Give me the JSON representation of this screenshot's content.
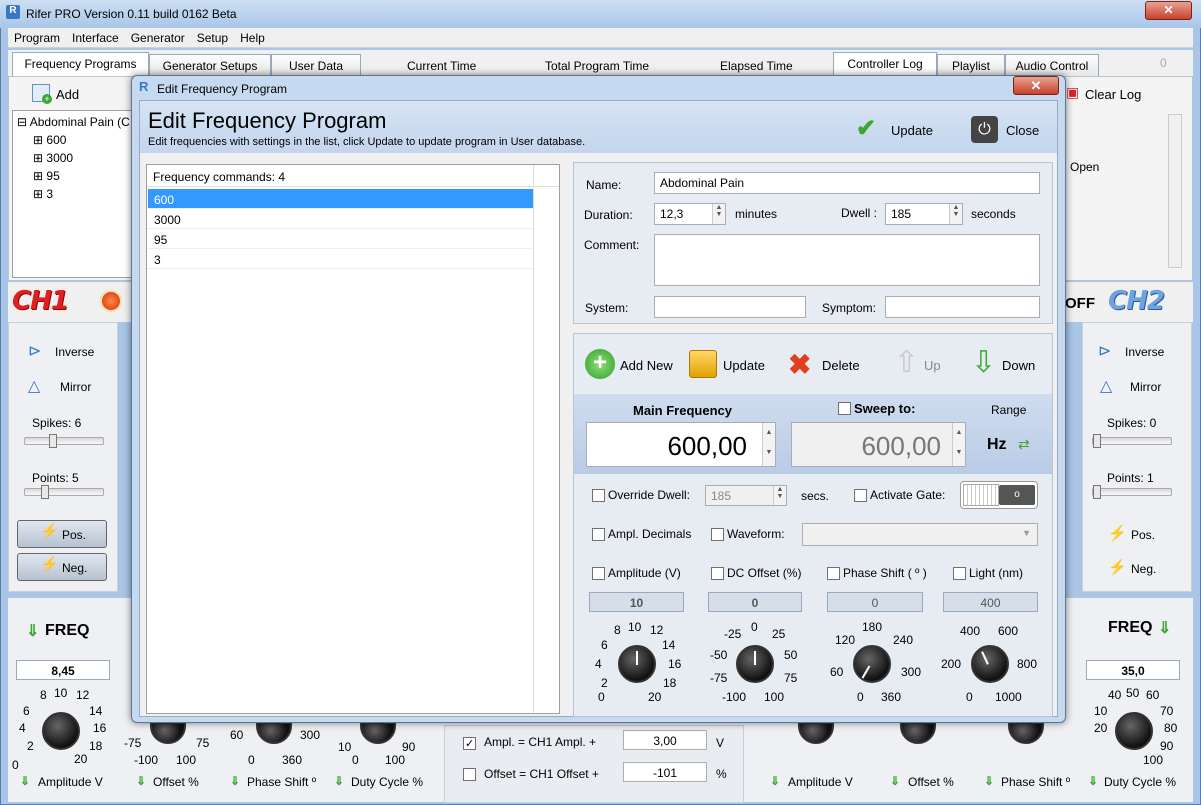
{
  "app": {
    "title": "Rifer PRO Version 0.11 build 0162 Beta"
  },
  "menu": [
    "Program",
    "Interface",
    "Generator",
    "Setup",
    "Help"
  ],
  "tabs": {
    "left": [
      "Frequency Programs",
      "Generator Setups",
      "User Data"
    ],
    "right": [
      "Controller Log",
      "Playlist",
      "Audio Control"
    ],
    "time_labels": [
      "Current Time",
      "Total Program Time",
      "Elapsed Time"
    ],
    "right_counter": "0"
  },
  "toolbar": {
    "add_label": "Add",
    "clear_log_label": "Clear Log",
    "open_label": "Open"
  },
  "tree": {
    "root": "Abdominal Pain (C",
    "items": [
      "600",
      "3000",
      "95",
      "3"
    ]
  },
  "ch1": {
    "label": "CH1",
    "inverse": "Inverse",
    "mirror": "Mirror",
    "spikes": "Spikes: 6",
    "points": "Points: 5",
    "pos": "Pos.",
    "neg": "Neg.",
    "freq_label": "FREQ",
    "freq_value": "8,45"
  },
  "ch2": {
    "label": "CH2",
    "off": "OFF",
    "inverse": "Inverse",
    "mirror": "Mirror",
    "spikes": "Spikes: 0",
    "points": "Points: 1",
    "pos": "Pos.",
    "neg": "Neg.",
    "freq_label": "FREQ",
    "freq_value": "35,0"
  },
  "bottom": {
    "amplitude_label": "Amplitude V",
    "offset_label": "Offset %",
    "phase_label": "Phase Shift º",
    "duty_label": "Duty Cycle %",
    "ampl_link": "Ampl. = CH1 Ampl. +",
    "ampl_link_value": "3,00",
    "ampl_unit": "V",
    "offset_link": "Offset = CH1 Offset +",
    "offset_link_value": "-101",
    "offset_unit": "%",
    "amp_ticks": [
      "0",
      "2",
      "4",
      "6",
      "8",
      "10",
      "12",
      "14",
      "16",
      "18",
      "20"
    ],
    "offset_ticks": [
      "-75",
      "-100",
      "100",
      "75"
    ],
    "phase_ticks": [
      "60",
      "0",
      "360",
      "300"
    ],
    "duty_ticks": [
      "10",
      "0",
      "100",
      "90"
    ],
    "right_amp_ticks": [
      "20",
      "40",
      "50",
      "60",
      "70",
      "80",
      "90",
      "100",
      "10"
    ]
  },
  "dialog": {
    "window_title": "Edit Frequency Program",
    "heading": "Edit Frequency Program",
    "subtitle": "Edit frequencies with settings in the list, click Update to update program in User database.",
    "update": "Update",
    "close": "Close",
    "list_header": "Frequency commands: 4",
    "frequencies": [
      "600",
      "3000",
      "95",
      "3"
    ],
    "name_label": "Name:",
    "name_value": "Abdominal Pain",
    "duration_label": "Duration:",
    "duration_value": "12,3",
    "duration_unit": "minutes",
    "dwell_label": "Dwell :",
    "dwell_value": "185",
    "dwell_unit": "seconds",
    "comment_label": "Comment:",
    "system_label": "System:",
    "symptom_label": "Symptom:",
    "add_new": "Add New",
    "update_btn": "Update",
    "delete": "Delete",
    "up": "Up",
    "down": "Down",
    "main_freq_label": "Main Frequency",
    "sweep_label": "Sweep to:",
    "range_label": "Range",
    "main_freq_value": "600,00",
    "sweep_value": "600,00",
    "hz": "Hz",
    "override_dwell": "Override Dwell:",
    "override_dwell_value": "185",
    "secs": "secs.",
    "activate_gate": "Activate Gate:",
    "ampl_decimals": "Ampl. Decimals",
    "waveform": "Waveform:",
    "amplitude": "Amplitude (V)",
    "dc_offset": "DC Offset (%)",
    "phase_shift": "Phase Shift ( º )",
    "light": "Light (nm)",
    "amplitude_value": "10",
    "dc_offset_value": "0",
    "phase_value": "0",
    "light_value": "400",
    "amp_knob_ticks": [
      "0",
      "2",
      "4",
      "6",
      "8",
      "10",
      "12",
      "14",
      "16",
      "18",
      "20"
    ],
    "dc_knob_ticks": [
      "-100",
      "-75",
      "-50",
      "-25",
      "0",
      "25",
      "50",
      "75",
      "100"
    ],
    "phase_knob_ticks": [
      "0",
      "60",
      "120",
      "180",
      "240",
      "300",
      "360"
    ],
    "light_knob_ticks": [
      "0",
      "200",
      "400",
      "600",
      "800",
      "1000"
    ]
  },
  "colors": {
    "selection": "#3399ff",
    "ch1": "#e02020",
    "ch2": "#6ea3e0",
    "accent_green": "#3aa832"
  }
}
